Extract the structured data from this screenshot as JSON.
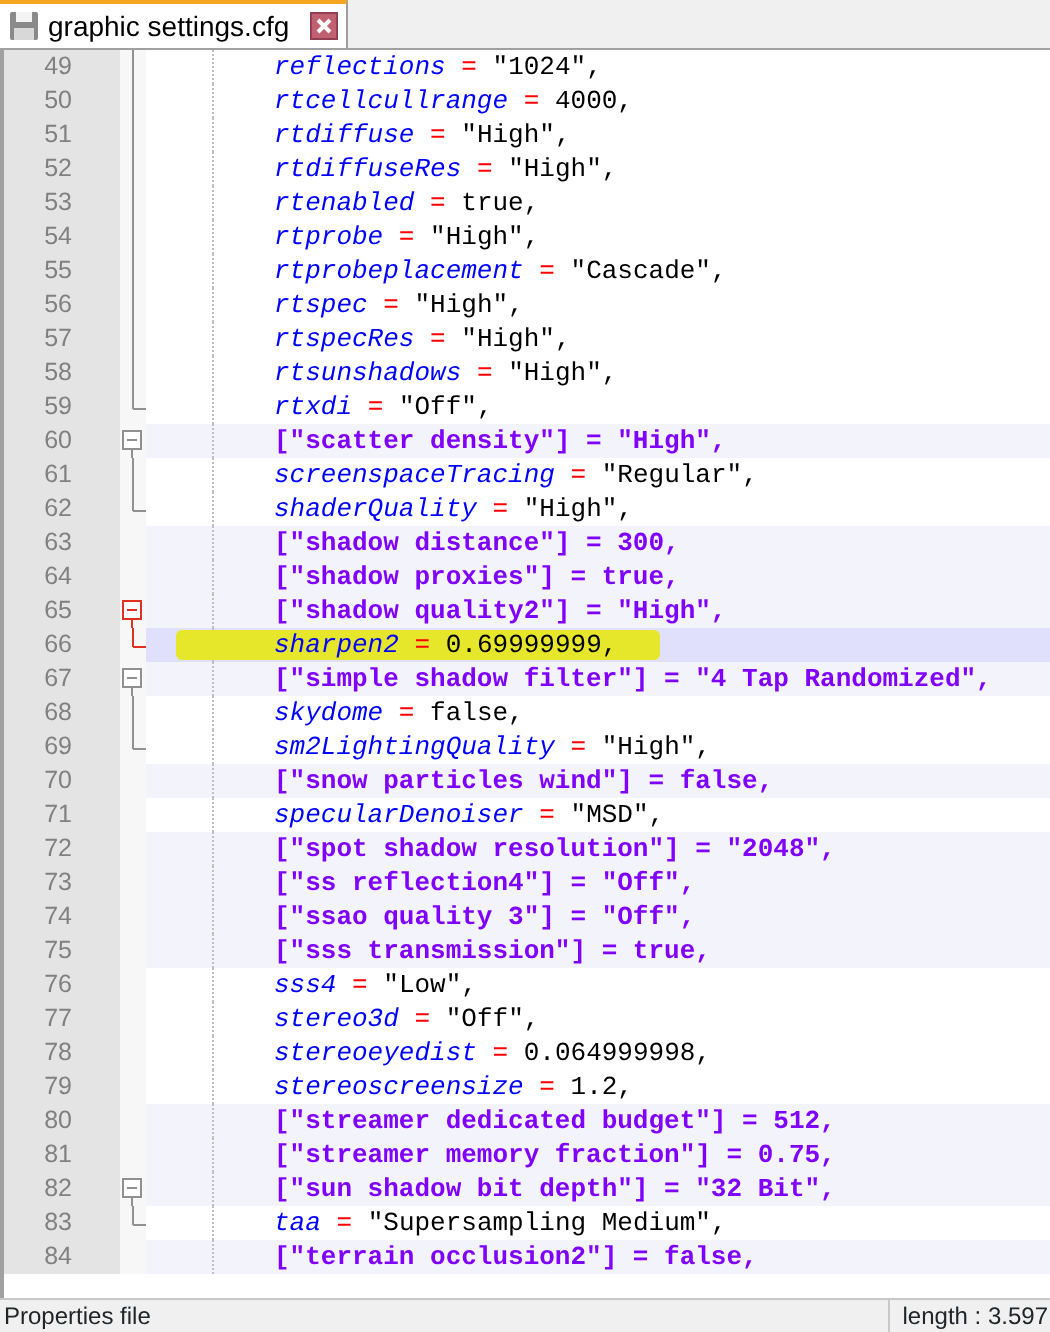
{
  "tab": {
    "title": "graphic settings.cfg",
    "selected": true
  },
  "lines": [
    {
      "number": "49",
      "kind": "key",
      "key": "reflections",
      "op": "=",
      "value": "\"1024\",",
      "fold_start": false,
      "fold_body": true,
      "fold_end": false,
      "fold_active": false,
      "current": false,
      "marked": false
    },
    {
      "number": "50",
      "kind": "key",
      "key": "rtcellcullrange",
      "op": "=",
      "value": "4000,",
      "fold_start": false,
      "fold_body": true,
      "fold_end": false,
      "fold_active": false,
      "current": false,
      "marked": false
    },
    {
      "number": "51",
      "kind": "key",
      "key": "rtdiffuse",
      "op": "=",
      "value": "\"High\",",
      "fold_start": false,
      "fold_body": true,
      "fold_end": false,
      "fold_active": false,
      "current": false,
      "marked": false
    },
    {
      "number": "52",
      "kind": "key",
      "key": "rtdiffuseRes",
      "op": "=",
      "value": "\"High\",",
      "fold_start": false,
      "fold_body": true,
      "fold_end": false,
      "fold_active": false,
      "current": false,
      "marked": false
    },
    {
      "number": "53",
      "kind": "key",
      "key": "rtenabled",
      "op": "=",
      "value": "true,",
      "fold_start": false,
      "fold_body": true,
      "fold_end": false,
      "fold_active": false,
      "current": false,
      "marked": false
    },
    {
      "number": "54",
      "kind": "key",
      "key": "rtprobe",
      "op": "=",
      "value": "\"High\",",
      "fold_start": false,
      "fold_body": true,
      "fold_end": false,
      "fold_active": false,
      "current": false,
      "marked": false
    },
    {
      "number": "55",
      "kind": "key",
      "key": "rtprobeplacement",
      "op": "=",
      "value": "\"Cascade\",",
      "fold_start": false,
      "fold_body": true,
      "fold_end": false,
      "fold_active": false,
      "current": false,
      "marked": false
    },
    {
      "number": "56",
      "kind": "key",
      "key": "rtspec",
      "op": "=",
      "value": "\"High\",",
      "fold_start": false,
      "fold_body": true,
      "fold_end": false,
      "fold_active": false,
      "current": false,
      "marked": false
    },
    {
      "number": "57",
      "kind": "key",
      "key": "rtspecRes",
      "op": "=",
      "value": "\"High\",",
      "fold_start": false,
      "fold_body": true,
      "fold_end": false,
      "fold_active": false,
      "current": false,
      "marked": false
    },
    {
      "number": "58",
      "kind": "key",
      "key": "rtsunshadows",
      "op": "=",
      "value": "\"High\",",
      "fold_start": false,
      "fold_body": true,
      "fold_end": false,
      "fold_active": false,
      "current": false,
      "marked": false
    },
    {
      "number": "59",
      "kind": "key",
      "key": "rtxdi",
      "op": "=",
      "value": "\"Off\",",
      "fold_start": false,
      "fold_body": false,
      "fold_end": true,
      "fold_active": false,
      "current": false,
      "marked": false
    },
    {
      "number": "60",
      "kind": "bracket",
      "key": "[\"scatter density\"]",
      "op": "=",
      "value": "\"High\",",
      "fold_start": true,
      "fold_body": false,
      "fold_end": false,
      "fold_active": false,
      "current": false,
      "marked": false
    },
    {
      "number": "61",
      "kind": "key",
      "key": "screenspaceTracing",
      "op": "=",
      "value": "\"Regular\",",
      "fold_start": false,
      "fold_body": true,
      "fold_end": false,
      "fold_active": false,
      "current": false,
      "marked": false
    },
    {
      "number": "62",
      "kind": "key",
      "key": "shaderQuality",
      "op": "=",
      "value": "\"High\",",
      "fold_start": false,
      "fold_body": false,
      "fold_end": true,
      "fold_active": false,
      "current": false,
      "marked": false
    },
    {
      "number": "63",
      "kind": "bracket",
      "key": "[\"shadow distance\"]",
      "op": "=",
      "value": "300,",
      "fold_start": false,
      "fold_body": false,
      "fold_end": false,
      "current": false,
      "marked": false
    },
    {
      "number": "64",
      "kind": "bracket",
      "key": "[\"shadow proxies\"]",
      "op": "=",
      "value": "true,",
      "fold_start": false,
      "fold_body": false,
      "fold_end": false,
      "current": false,
      "marked": false
    },
    {
      "number": "65",
      "kind": "bracket",
      "key": "[\"shadow quality2\"]",
      "op": "=",
      "value": "\"High\",",
      "fold_start": true,
      "fold_body": false,
      "fold_end": false,
      "fold_active": true,
      "current": false,
      "marked": false
    },
    {
      "number": "66",
      "kind": "key",
      "key": "sharpen2",
      "op": "=",
      "value": "0.69999999,",
      "fold_start": false,
      "fold_body": false,
      "fold_end": true,
      "fold_active": true,
      "current": true,
      "marked": true
    },
    {
      "number": "67",
      "kind": "bracket",
      "key": "[\"simple shadow filter\"]",
      "op": "=",
      "value": "\"4 Tap Randomized\",",
      "fold_start": true,
      "fold_body": false,
      "fold_end": false,
      "fold_active": false,
      "current": false,
      "marked": false
    },
    {
      "number": "68",
      "kind": "key",
      "key": "skydome",
      "op": "=",
      "value": "false,",
      "fold_start": false,
      "fold_body": true,
      "fold_end": false,
      "fold_active": false,
      "current": false,
      "marked": false
    },
    {
      "number": "69",
      "kind": "key",
      "key": "sm2LightingQuality",
      "op": "=",
      "value": "\"High\",",
      "fold_start": false,
      "fold_body": false,
      "fold_end": true,
      "fold_active": false,
      "current": false,
      "marked": false
    },
    {
      "number": "70",
      "kind": "bracket",
      "key": "[\"snow particles wind\"]",
      "op": "=",
      "value": "false,",
      "fold_start": false,
      "fold_body": false,
      "fold_end": false,
      "current": false,
      "marked": false
    },
    {
      "number": "71",
      "kind": "key",
      "key": "specularDenoiser",
      "op": "=",
      "value": "\"MSD\",",
      "fold_start": false,
      "fold_body": false,
      "fold_end": false,
      "current": false,
      "marked": false
    },
    {
      "number": "72",
      "kind": "bracket",
      "key": "[\"spot shadow resolution\"]",
      "op": "=",
      "value": "\"2048\",",
      "fold_start": false,
      "fold_body": false,
      "fold_end": false,
      "current": false,
      "marked": false
    },
    {
      "number": "73",
      "kind": "bracket",
      "key": "[\"ss reflection4\"]",
      "op": "=",
      "value": "\"Off\",",
      "fold_start": false,
      "fold_body": false,
      "fold_end": false,
      "current": false,
      "marked": false
    },
    {
      "number": "74",
      "kind": "bracket",
      "key": "[\"ssao quality 3\"]",
      "op": "=",
      "value": "\"Off\",",
      "fold_start": false,
      "fold_body": false,
      "fold_end": false,
      "current": false,
      "marked": false
    },
    {
      "number": "75",
      "kind": "bracket",
      "key": "[\"sss transmission\"]",
      "op": "=",
      "value": "true,",
      "fold_start": false,
      "fold_body": false,
      "fold_end": false,
      "current": false,
      "marked": false
    },
    {
      "number": "76",
      "kind": "key",
      "key": "sss4",
      "op": "=",
      "value": "\"Low\",",
      "fold_start": false,
      "fold_body": false,
      "fold_end": false,
      "current": false,
      "marked": false
    },
    {
      "number": "77",
      "kind": "key",
      "key": "stereo3d",
      "op": "=",
      "value": "\"Off\",",
      "fold_start": false,
      "fold_body": false,
      "fold_end": false,
      "current": false,
      "marked": false
    },
    {
      "number": "78",
      "kind": "key",
      "key": "stereoeyedist",
      "op": "=",
      "value": "0.064999998,",
      "fold_start": false,
      "fold_body": false,
      "fold_end": false,
      "current": false,
      "marked": false
    },
    {
      "number": "79",
      "kind": "key",
      "key": "stereoscreensize",
      "op": "=",
      "value": "1.2,",
      "fold_start": false,
      "fold_body": false,
      "fold_end": false,
      "current": false,
      "marked": false
    },
    {
      "number": "80",
      "kind": "bracket",
      "key": "[\"streamer dedicated budget\"]",
      "op": "=",
      "value": "512,",
      "fold_start": false,
      "fold_body": false,
      "fold_end": false,
      "current": false,
      "marked": false
    },
    {
      "number": "81",
      "kind": "bracket",
      "key": "[\"streamer memory fraction\"]",
      "op": "=",
      "value": "0.75,",
      "fold_start": false,
      "fold_body": false,
      "fold_end": false,
      "current": false,
      "marked": false
    },
    {
      "number": "82",
      "kind": "bracket",
      "key": "[\"sun shadow bit depth\"]",
      "op": "=",
      "value": "\"32 Bit\",",
      "fold_start": true,
      "fold_body": false,
      "fold_end": false,
      "fold_active": false,
      "current": false,
      "marked": false
    },
    {
      "number": "83",
      "kind": "key",
      "key": "taa",
      "op": "=",
      "value": "\"Supersampling Medium\",",
      "fold_start": false,
      "fold_body": false,
      "fold_end": true,
      "fold_active": false,
      "current": false,
      "marked": false
    },
    {
      "number": "84",
      "kind": "bracket",
      "key": "[\"terrain occlusion2\"]",
      "op": "=",
      "value": "false,",
      "fold_start": false,
      "fold_body": false,
      "fold_end": false,
      "current": false,
      "marked": false
    }
  ],
  "status_bar": {
    "file_type": "Properties file",
    "length": "length : 3.597"
  }
}
